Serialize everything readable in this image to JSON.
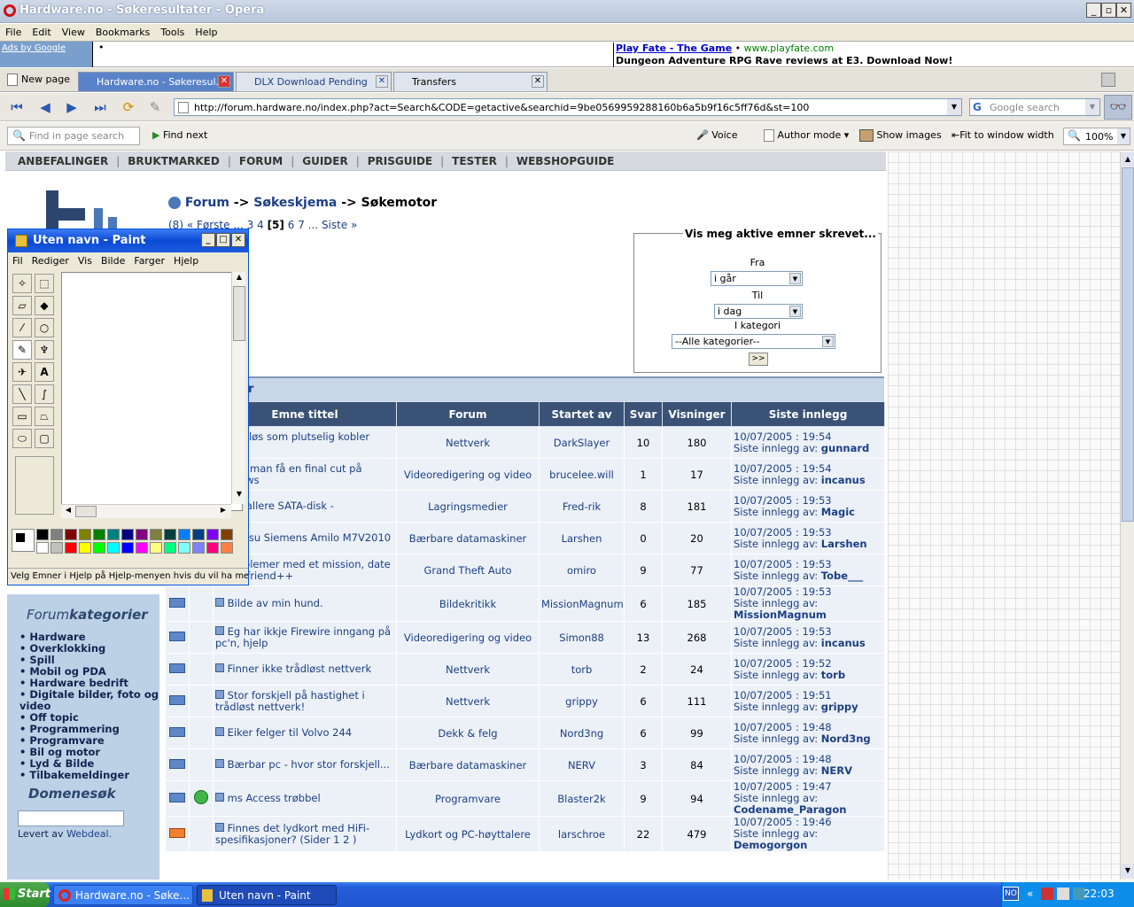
{
  "window": {
    "title": "Hardware.no - Søkeresultater - Opera"
  },
  "menubar": [
    "File",
    "Edit",
    "View",
    "Bookmarks",
    "Tools",
    "Help"
  ],
  "ads": {
    "ads_by": "Ads by Google",
    "bullet": "•",
    "link": "Play Fate - The Game",
    "sep": "•",
    "url": "www.playfate.com",
    "text": "Dungeon Adventure RPG Rave reviews at E3. Download Now!"
  },
  "tabs": {
    "new_page": "New page",
    "t1": "Hardware.no - Søkeresul...",
    "t2": "DLX Download Pending",
    "t3": "Transfers"
  },
  "address": {
    "url": "http://forum.hardware.no/index.php?act=Search&CODE=getactive&searchid=9be0569959288160b6a5b9f16c5ff76d&st=100",
    "search_placeholder": "Google search"
  },
  "findbar": {
    "find_placeholder": "Find in page search",
    "find_next": "Find next",
    "voice": "Voice",
    "author_mode": "Author mode",
    "show_images": "Show images",
    "fit": "Fit to window width",
    "zoom": "100%"
  },
  "sitenav": [
    "ANBEFALINGER",
    "BRUKTMARKED",
    "FORUM",
    "GUIDER",
    "PRISGUIDE",
    "TESTER",
    "WEBSHOPGUIDE"
  ],
  "sitenav_sep": "|",
  "breadcrumb": {
    "forum": "Forum",
    "arrow1": "->",
    "sok": "Søkeskjema",
    "arrow2": "->",
    "motor": "Søkemotor"
  },
  "pagination": {
    "count": "(8)",
    "first": "« Første",
    "dots": "...",
    "p3": "3",
    "p4": "4",
    "current": "[5]",
    "p6": "6",
    "p7": "7",
    "ellipsis": "...",
    "last": "Siste »"
  },
  "filter": {
    "legend": "Vis meg aktive emner skrevet...",
    "from_label": "Fra",
    "from_value": "i går",
    "to_label": "Til",
    "to_value": "i dag",
    "cat_label": "I kategori",
    "cat_value": "--Alle kategorier--",
    "go": ">>"
  },
  "table_caption": "r",
  "columns": {
    "title": "Emne tittel",
    "forum": "Forum",
    "started": "Startet av",
    "replies": "Svar",
    "views": "Visninger",
    "last": "Siste innlegg"
  },
  "last_prefix": "Siste innlegg av:",
  "rows": [
    {
      "title": "Trådløs som plutselig kobler fra...",
      "forum": "Nettverk",
      "starter": "DarkSlayer",
      "replies": "10",
      "views": "180",
      "date": "10/07/2005 : 19:54",
      "by": "gunnard"
    },
    {
      "title": "Kan man få en final cut på windows",
      "forum": "Videoredigering og video",
      "starter": "brucelee.will",
      "replies": "1",
      "views": "17",
      "date": "10/07/2005 : 19:54",
      "by": "incanus"
    },
    {
      "title": "Installere SATA-disk -",
      "forum": "Lagringsmedier",
      "starter": "Fred-rik",
      "replies": "8",
      "views": "181",
      "date": "10/07/2005 : 19:53",
      "by": "Magic"
    },
    {
      "title": "Fujitsu Siemens Amilo M7V2010",
      "forum": "Bærbare datamaskiner",
      "starter": "Larshen",
      "replies": "0",
      "views": "20",
      "date": "10/07/2005 : 19:53",
      "by": "Larshen"
    },
    {
      "title": "Problemer med et mission, date @ Girlfriend++",
      "forum": "Grand Theft Auto",
      "starter": "omiro",
      "replies": "9",
      "views": "77",
      "date": "10/07/2005 : 19:53",
      "by": "Tobe___"
    },
    {
      "title": "Bilde av min hund.",
      "forum": "Bildekritikk",
      "starter": "MissionMagnum",
      "replies": "6",
      "views": "185",
      "date": "10/07/2005 : 19:53",
      "by": "MissionMagnum"
    },
    {
      "title": "Eg har ikkje Firewire inngang på pc'n, hjelp",
      "forum": "Videoredigering og video",
      "starter": "Simon88",
      "replies": "13",
      "views": "268",
      "date": "10/07/2005 : 19:53",
      "by": "incanus"
    },
    {
      "title": "Finner ikke trådløst nettverk",
      "forum": "Nettverk",
      "starter": "torb",
      "replies": "2",
      "views": "24",
      "date": "10/07/2005 : 19:52",
      "by": "torb"
    },
    {
      "title": "Stor forskjell på hastighet i trådløst nettverk!",
      "forum": "Nettverk",
      "starter": "grippy",
      "replies": "6",
      "views": "111",
      "date": "10/07/2005 : 19:51",
      "by": "grippy"
    },
    {
      "title": "Eiker felger til Volvo 244",
      "forum": "Dekk & felg",
      "starter": "Nord3ng",
      "replies": "6",
      "views": "99",
      "date": "10/07/2005 : 19:48",
      "by": "Nord3ng"
    },
    {
      "title": "Bærbar pc - hvor stor forskjell...",
      "forum": "Bærbare datamaskiner",
      "starter": "NERV",
      "replies": "3",
      "views": "84",
      "date": "10/07/2005 : 19:48",
      "by": "NERV"
    },
    {
      "title": "ms Access trøbbel",
      "forum": "Programvare",
      "starter": "Blaster2k",
      "replies": "9",
      "views": "94",
      "date": "10/07/2005 : 19:47",
      "by": "Codename_Paragon"
    },
    {
      "title": "Finnes det lydkort med HiFi-spesifikasjoner? (Sider 1 2 )",
      "forum": "Lydkort og PC-høyttalere",
      "starter": "larschroe",
      "replies": "22",
      "views": "479",
      "date": "10/07/2005 : 19:46",
      "by": "Demogorgon"
    }
  ],
  "sidebar": {
    "forumkat_a": "Forum",
    "forumkat_b": "kategorier",
    "cats": [
      "• Hardware",
      "• Overklokking",
      "• Spill",
      "• Mobil og PDA",
      "• Hardware bedrift",
      "• Digitale bilder, foto og video",
      "• Off topic",
      "• Programmering",
      "• Programvare",
      "• Bil og motor",
      "• Lyd & Bilde",
      "• Tilbakemeldinger"
    ],
    "domain_a": "Domene",
    "domain_b": "søk",
    "levert_prefix": "Levert av",
    "levert_link": "Webdeal."
  },
  "paint": {
    "title": "Uten navn - Paint",
    "menu": [
      "Fil",
      "Rediger",
      "Vis",
      "Bilde",
      "Farger",
      "Hjelp"
    ],
    "status": "Velg Emner i Hjelp på Hjelp-menyen hvis du vil ha me",
    "palette_top": [
      "#000000",
      "#808080",
      "#800000",
      "#808000",
      "#008000",
      "#008080",
      "#000080",
      "#800080",
      "#808040",
      "#004040",
      "#0080ff",
      "#004080",
      "#8000ff",
      "#804000"
    ],
    "palette_bottom": [
      "#ffffff",
      "#c0c0c0",
      "#ff0000",
      "#ffff00",
      "#00ff00",
      "#00ffff",
      "#0000ff",
      "#ff00ff",
      "#ffff80",
      "#00ff80",
      "#80ffff",
      "#8080ff",
      "#ff0080",
      "#ff8040"
    ]
  },
  "taskbar": {
    "start": "Start",
    "task1": "Hardware.no - Søke...",
    "task2": "Uten navn - Paint",
    "lang": "NO",
    "arrows": "«",
    "clock": "22:03"
  }
}
